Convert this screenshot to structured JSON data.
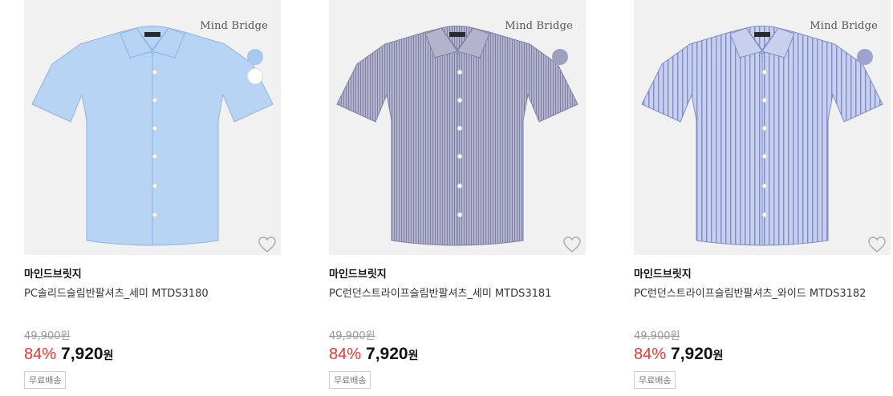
{
  "products": [
    {
      "image_label": "Mind Bridge",
      "swatches": [
        "#a8c8ef",
        "#ffffff"
      ],
      "shirt_color": "#b7d4f5",
      "shirt_stroke": "#8fb3e0",
      "pattern": "solid",
      "brand": "마인드브릿지",
      "name": "PC솔리드슬림반팔셔츠_세미 MTDS3180",
      "original_price": "49,900원",
      "discount": "84%",
      "price": "7,920",
      "currency": "원",
      "badge": "무료배송"
    },
    {
      "image_label": "Mind Bridge",
      "swatches": [
        "#9ea0c0"
      ],
      "shirt_color": "#b3b4cc",
      "shirt_stroke": "#7d80a6",
      "pattern": "fine",
      "brand": "마인드브릿지",
      "name": "PC런던스트라이프슬림반팔셔츠_세미 MTDS3181",
      "original_price": "49,900원",
      "discount": "84%",
      "price": "7,920",
      "currency": "원",
      "badge": "무료배송"
    },
    {
      "image_label": "Mind Bridge",
      "swatches": [
        "#9aa4cf"
      ],
      "shirt_color": "#c9d0ec",
      "shirt_stroke": "#7e8cc6",
      "pattern": "stripe",
      "brand": "마인드브릿지",
      "name": "PC런던스트라이프슬림반팔셔츠_와이드 MTDS3182",
      "original_price": "49,900원",
      "discount": "84%",
      "price": "7,920",
      "currency": "원",
      "badge": "무료배송"
    }
  ]
}
